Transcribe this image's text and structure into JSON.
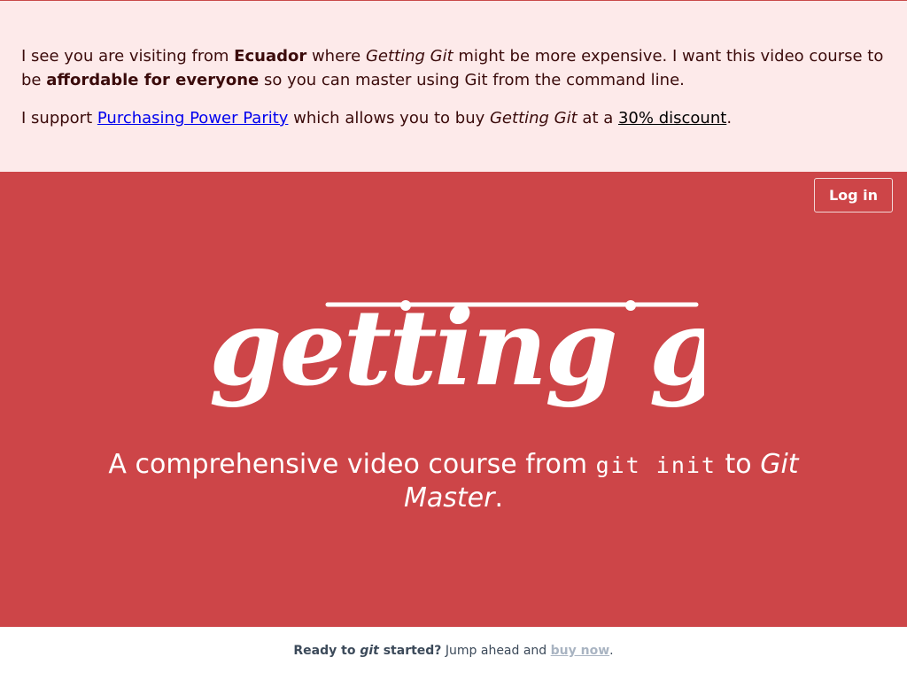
{
  "ppp": {
    "line1_prefix": "I see you are visiting from ",
    "country": "Ecuador",
    "line1_mid": " where ",
    "course_name": "Getting Git",
    "line1_suffix": " might be more expensive. I want this video course to be ",
    "affordable": "affordable for everyone",
    "line1_end": " so you can master using Git from the command line.",
    "line2_prefix": "I support ",
    "ppp_link": "Purchasing Power Parity",
    "line2_mid": " which allows you to buy ",
    "line2_course": "Getting Git",
    "line2_at": " at a ",
    "discount_link": "30% discount",
    "line2_end": "."
  },
  "header": {
    "login_label": "Log in"
  },
  "hero": {
    "logo_text": "getting git",
    "tagline_prefix": "A comprehensive video course from ",
    "tagline_code": "git init",
    "tagline_mid": " to ",
    "tagline_em": "Git Master",
    "tagline_end": "."
  },
  "footer": {
    "ready": "Ready to ",
    "git": "git",
    "started": " started?",
    "jump": " Jump ahead and ",
    "buy_link": "buy now",
    "end": "."
  },
  "colors": {
    "hero_bg": "#cd4548",
    "banner_bg": "#fdeaea",
    "link": "#0000ee"
  }
}
